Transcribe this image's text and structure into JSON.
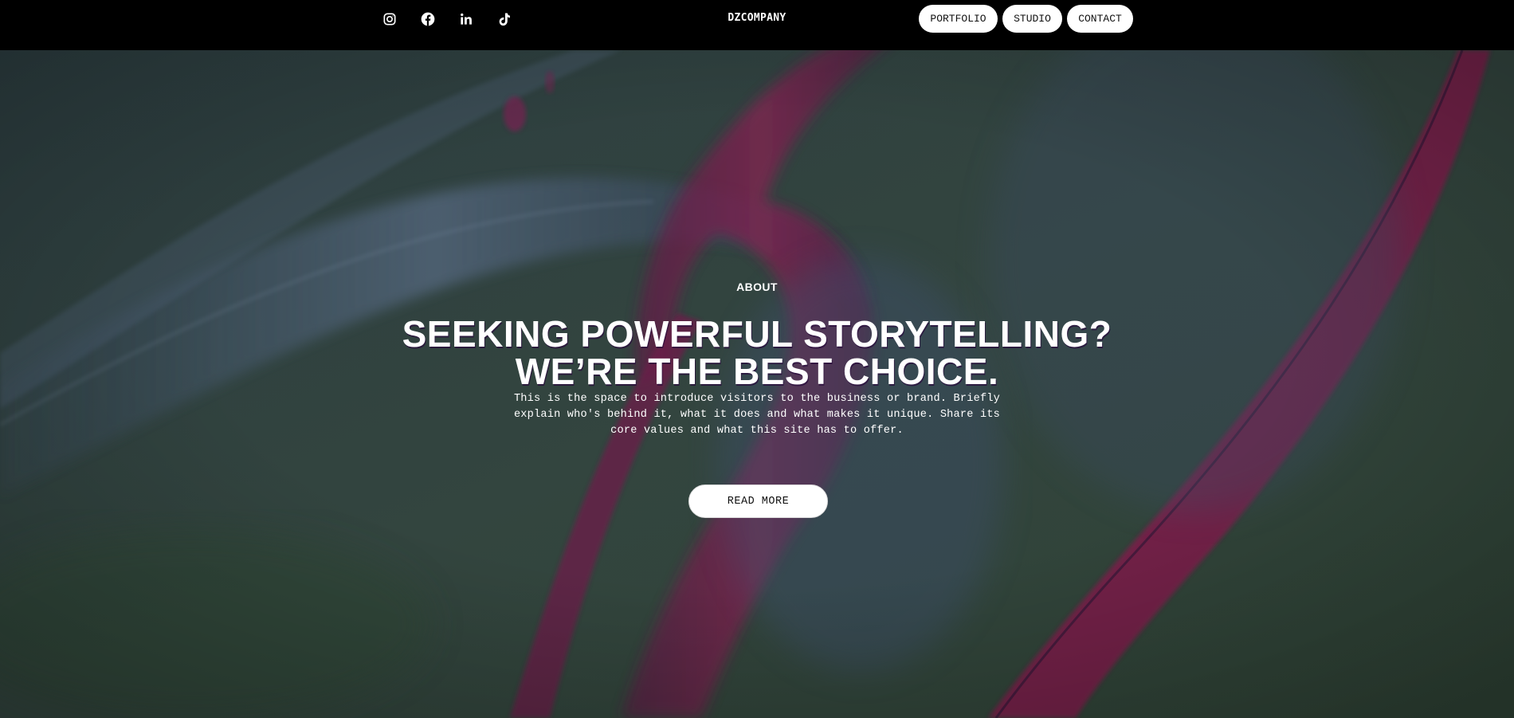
{
  "header": {
    "brand": "DZCOMPANY",
    "social_icons": [
      "instagram-icon",
      "facebook-icon",
      "linkedin-icon",
      "tiktok-icon"
    ],
    "nav": [
      {
        "label": "PORTFOLIO"
      },
      {
        "label": "STUDIO"
      },
      {
        "label": "CONTACT"
      }
    ]
  },
  "hero": {
    "kicker": "ABOUT",
    "headline_line1": "SEEKING POWERFUL STORYTELLING?",
    "headline_line2": "WE’RE THE BEST CHOICE.",
    "body_line1": "This is the space to introduce visitors to the business or brand. Briefly",
    "body_line2": "explain who's behind it, what it does and what makes it unique. Share its",
    "body_line3": "core values and what this site has to offer.",
    "cta_label": "READ MORE"
  },
  "colors": {
    "topbar": "#000000",
    "hero_base": "#2f403f",
    "ribbon_magenta": "#7a1d4e",
    "ribbon_blue": "#3b4e6e",
    "button_bg": "#ffffff",
    "text": "#ffffff"
  }
}
